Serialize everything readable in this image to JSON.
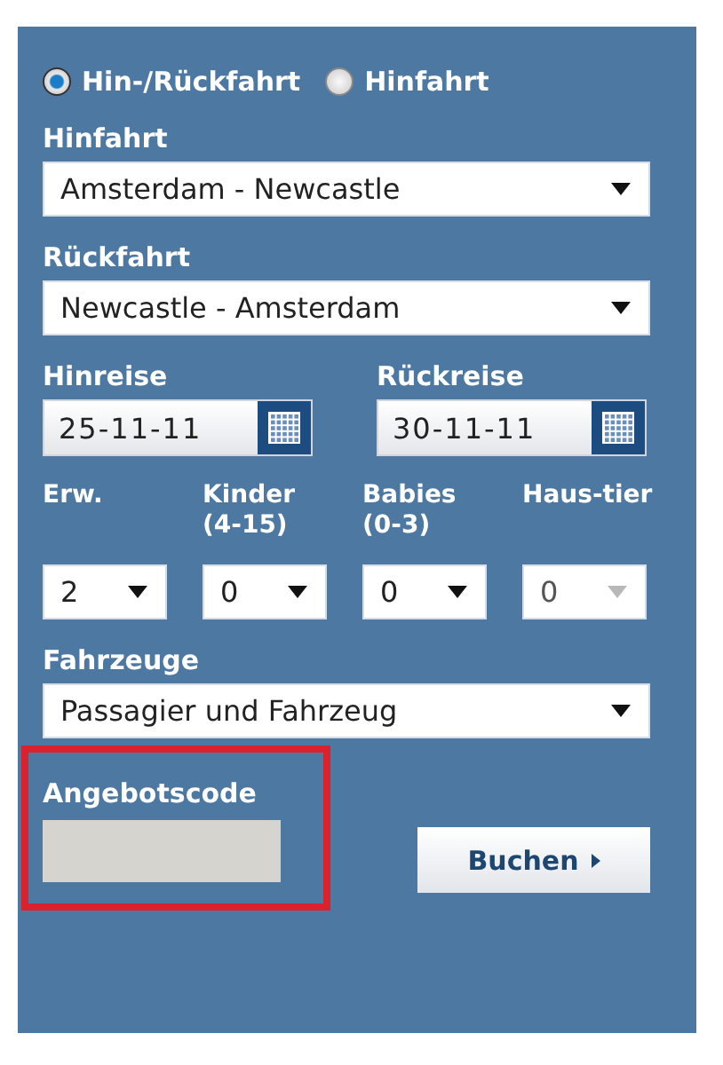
{
  "trip_type": [
    {
      "label": "Hin-/Rückfahrt",
      "selected": true
    },
    {
      "label": "Hinfahrt",
      "selected": false
    }
  ],
  "routes": [
    {
      "label": "Hinfahrt",
      "value": "Amsterdam - Newcastle"
    },
    {
      "label": "Rückfahrt",
      "value": "Newcastle - Amsterdam"
    }
  ],
  "dates": [
    {
      "label": "Hinreise",
      "value": "25-11-11"
    },
    {
      "label": "Rückreise",
      "value": "30-11-11"
    }
  ],
  "passengers": [
    {
      "label": "Erw.",
      "value": "2",
      "disabled": false
    },
    {
      "label": "Kinder (4-15)",
      "value": "0",
      "disabled": false
    },
    {
      "label": "Babies (0-3)",
      "value": "0",
      "disabled": false
    },
    {
      "label": "Haus-tier",
      "value": "0",
      "disabled": true
    }
  ],
  "vehicles": {
    "label": "Fahrzeuge",
    "value": "Passagier und Fahrzeug"
  },
  "promo_code": {
    "label": "Angebotscode",
    "highlighted": true
  },
  "submit": {
    "label": "Buchen"
  }
}
